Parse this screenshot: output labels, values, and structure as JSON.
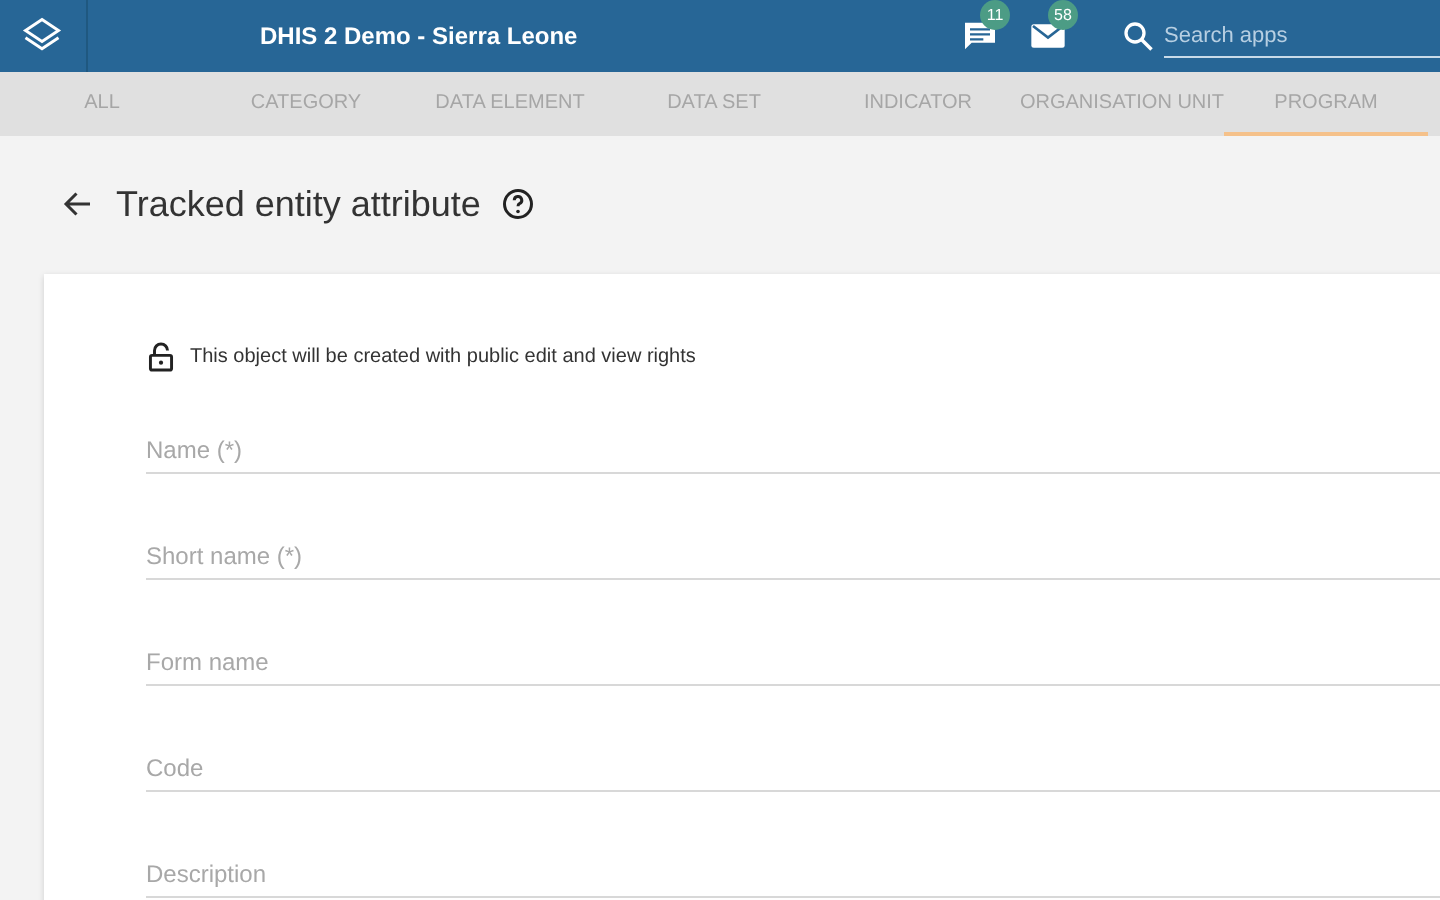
{
  "header": {
    "title": "DHIS 2 Demo - Sierra Leone",
    "messages_badge": "11",
    "mail_badge": "58",
    "search": {
      "placeholder": "Search apps"
    }
  },
  "tabs": [
    {
      "label": "ALL",
      "selected": false
    },
    {
      "label": "CATEGORY",
      "selected": false
    },
    {
      "label": "DATA ELEMENT",
      "selected": false
    },
    {
      "label": "DATA SET",
      "selected": false
    },
    {
      "label": "INDICATOR",
      "selected": false
    },
    {
      "label": "ORGANISATION UNIT",
      "selected": false
    },
    {
      "label": "PROGRAM",
      "selected": true
    }
  ],
  "page": {
    "title": "Tracked entity attribute"
  },
  "form": {
    "notice": "This object will be created with public edit and view rights",
    "fields": [
      {
        "placeholder": "Name (*)"
      },
      {
        "placeholder": "Short name (*)"
      },
      {
        "placeholder": "Form name"
      },
      {
        "placeholder": "Code"
      },
      {
        "placeholder": "Description"
      }
    ]
  }
}
